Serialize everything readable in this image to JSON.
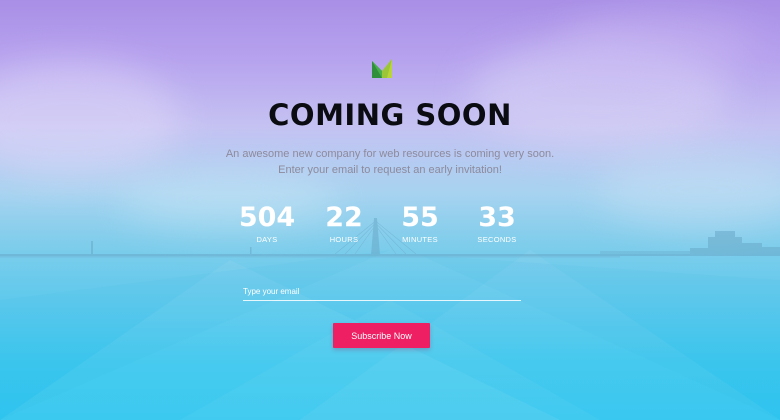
{
  "hero": {
    "title": "COMING SOON",
    "subtitle_line1": "An awesome new company for web resources is coming very soon.",
    "subtitle_line2": "Enter your email to request an early invitation!"
  },
  "countdown": {
    "days": {
      "value": "504",
      "label": "DAYS"
    },
    "hours": {
      "value": "22",
      "label": "HOURS"
    },
    "minutes": {
      "value": "55",
      "label": "MINUTES"
    },
    "seconds": {
      "value": "33",
      "label": "SECONDS"
    }
  },
  "form": {
    "email_placeholder": "Type your email",
    "email_value": "",
    "subscribe_label": "Subscribe Now"
  },
  "icons": {
    "logo": "m-logo-icon"
  },
  "colors": {
    "accent": "#ef1f63",
    "title": "#0b0b12",
    "subtitle": "#8d8a9c",
    "sky_top": "#a98fe6",
    "sky_bottom": "#2fc6f0",
    "logo_green": "#3aa83c",
    "logo_yellow": "#c6d93a"
  }
}
